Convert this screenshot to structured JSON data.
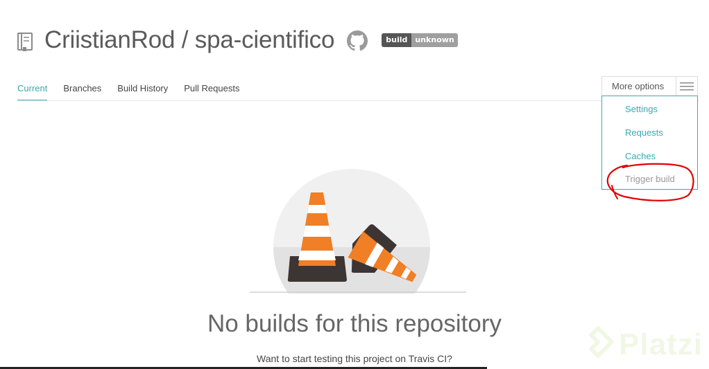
{
  "repo": {
    "owner": "CriistianRod",
    "separator": "/",
    "name": "spa-cientifico",
    "title": "CriistianRod / spa-cientifico"
  },
  "badge": {
    "left": "build",
    "right": "unknown",
    "left_color": "#555555",
    "right_color": "#9f9f9f"
  },
  "tabs": [
    {
      "label": "Current",
      "active": true
    },
    {
      "label": "Branches",
      "active": false
    },
    {
      "label": "Build History",
      "active": false
    },
    {
      "label": "Pull Requests",
      "active": false
    }
  ],
  "more_options": {
    "label": "More options",
    "icon": "hamburger-menu-icon",
    "items": [
      {
        "label": "Settings"
      },
      {
        "label": "Requests"
      },
      {
        "label": "Caches"
      },
      {
        "label": "Trigger build",
        "disabled": true
      }
    ]
  },
  "empty_state": {
    "title": "No builds for this repository",
    "subtitle": "Want to start testing this project on Travis CI?"
  },
  "watermark": {
    "text": "Platzi"
  },
  "colors": {
    "accent": "#39aaaf",
    "cone_orange": "#f07f25",
    "annotation_red": "#e00000"
  }
}
